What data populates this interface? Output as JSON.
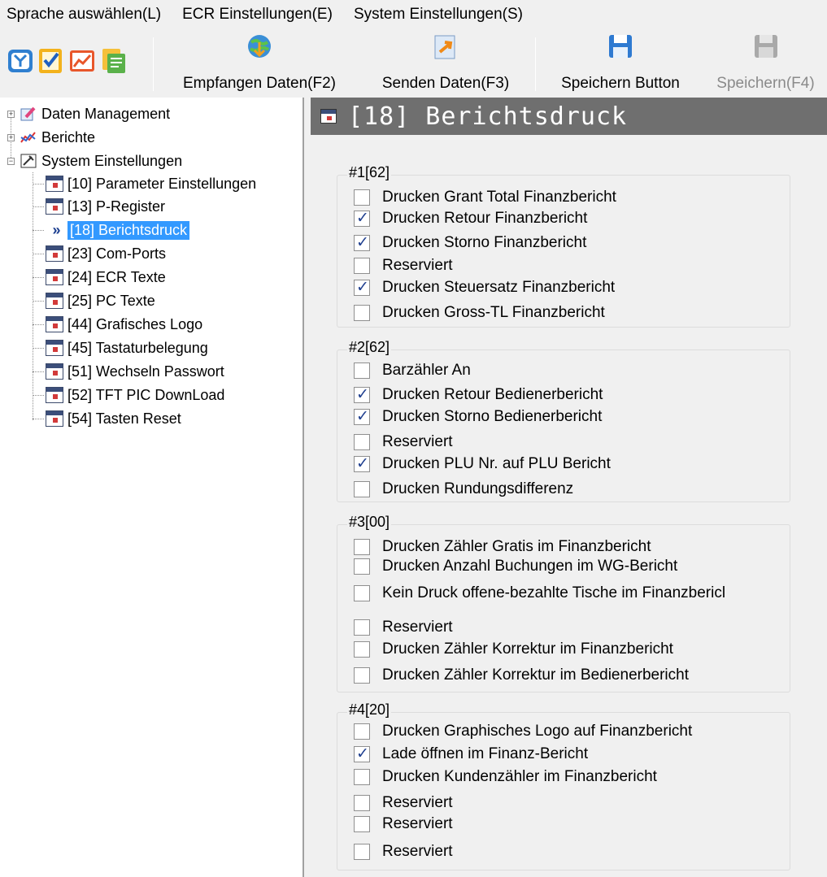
{
  "menu": {
    "items": [
      "Sprache auswählen(L)",
      "ECR Einstellungen(E)",
      "System Einstellungen(S)"
    ]
  },
  "toolbar": {
    "small_icons": [
      "tools-icon",
      "checklist-icon",
      "chart-trend-icon",
      "notes-icon"
    ],
    "receive_label": "Empfangen Daten(F2)",
    "send_label": "Senden Daten(F3)",
    "save_button_label": "Speichern Button",
    "save_f4_label": "Speichern(F4)"
  },
  "tree": {
    "categories": [
      {
        "label": "Daten Management",
        "icon": "data-management-icon"
      },
      {
        "label": "Berichte",
        "icon": "reports-icon"
      },
      {
        "label": "System Einstellungen",
        "icon": "system-settings-icon"
      }
    ],
    "items": [
      "[10] Parameter Einstellungen",
      "[13] P-Register",
      "[18] Berichtsdruck",
      "[23] Com-Ports",
      "[24] ECR Texte",
      "[25] PC Texte",
      "[44] Grafisches Logo",
      "[45] Tastaturbelegung",
      "[51] Wechseln Passwort",
      "[52] TFT PIC DownLoad",
      "[54] Tasten Reset"
    ],
    "selected_marker": "»"
  },
  "content": {
    "title": "[18] Berichtsdruck",
    "groups": [
      {
        "title": "#1[62]",
        "options": [
          {
            "label": "Drucken Grant Total Finanzbericht",
            "checked": false
          },
          {
            "label": "Drucken Retour Finanzbericht",
            "checked": true
          },
          {
            "label": "Drucken Storno Finanzbericht",
            "checked": true
          },
          {
            "label": "Reserviert",
            "checked": false
          },
          {
            "label": "Drucken Steuersatz Finanzbericht",
            "checked": true
          },
          {
            "label": "Drucken Gross-TL Finanzbericht",
            "checked": false
          }
        ]
      },
      {
        "title": "#2[62]",
        "options": [
          {
            "label": "Barzähler An",
            "checked": false
          },
          {
            "label": "Drucken Retour Bedienerbericht",
            "checked": true
          },
          {
            "label": "Drucken Storno Bedienerbericht",
            "checked": true
          },
          {
            "label": "Reserviert",
            "checked": false
          },
          {
            "label": "Drucken PLU Nr. auf PLU Bericht",
            "checked": true
          },
          {
            "label": "Drucken Rundungsdifferenz",
            "checked": false
          }
        ]
      },
      {
        "title": "#3[00]",
        "options": [
          {
            "label": "Drucken Zähler Gratis im Finanzbericht",
            "checked": false
          },
          {
            "label": "Drucken Anzahl Buchungen im WG-Bericht",
            "checked": false
          },
          {
            "label": "Kein Druck offene-bezahlte Tische im Finanzbericl",
            "checked": false
          },
          {
            "label": "Reserviert",
            "checked": false
          },
          {
            "label": "Drucken Zähler Korrektur im Finanzbericht",
            "checked": false
          },
          {
            "label": "Drucken Zähler Korrektur im Bedienerbericht",
            "checked": false
          }
        ]
      },
      {
        "title": "#4[20]",
        "options": [
          {
            "label": "Drucken Graphisches Logo auf Finanzbericht",
            "checked": false
          },
          {
            "label": "Lade öffnen im Finanz-Bericht",
            "checked": true
          },
          {
            "label": "Drucken Kundenzähler im Finanzbericht",
            "checked": false
          },
          {
            "label": "Reserviert",
            "checked": false
          },
          {
            "label": "Reserviert",
            "checked": false
          },
          {
            "label": "Reserviert",
            "checked": false
          }
        ]
      }
    ]
  }
}
